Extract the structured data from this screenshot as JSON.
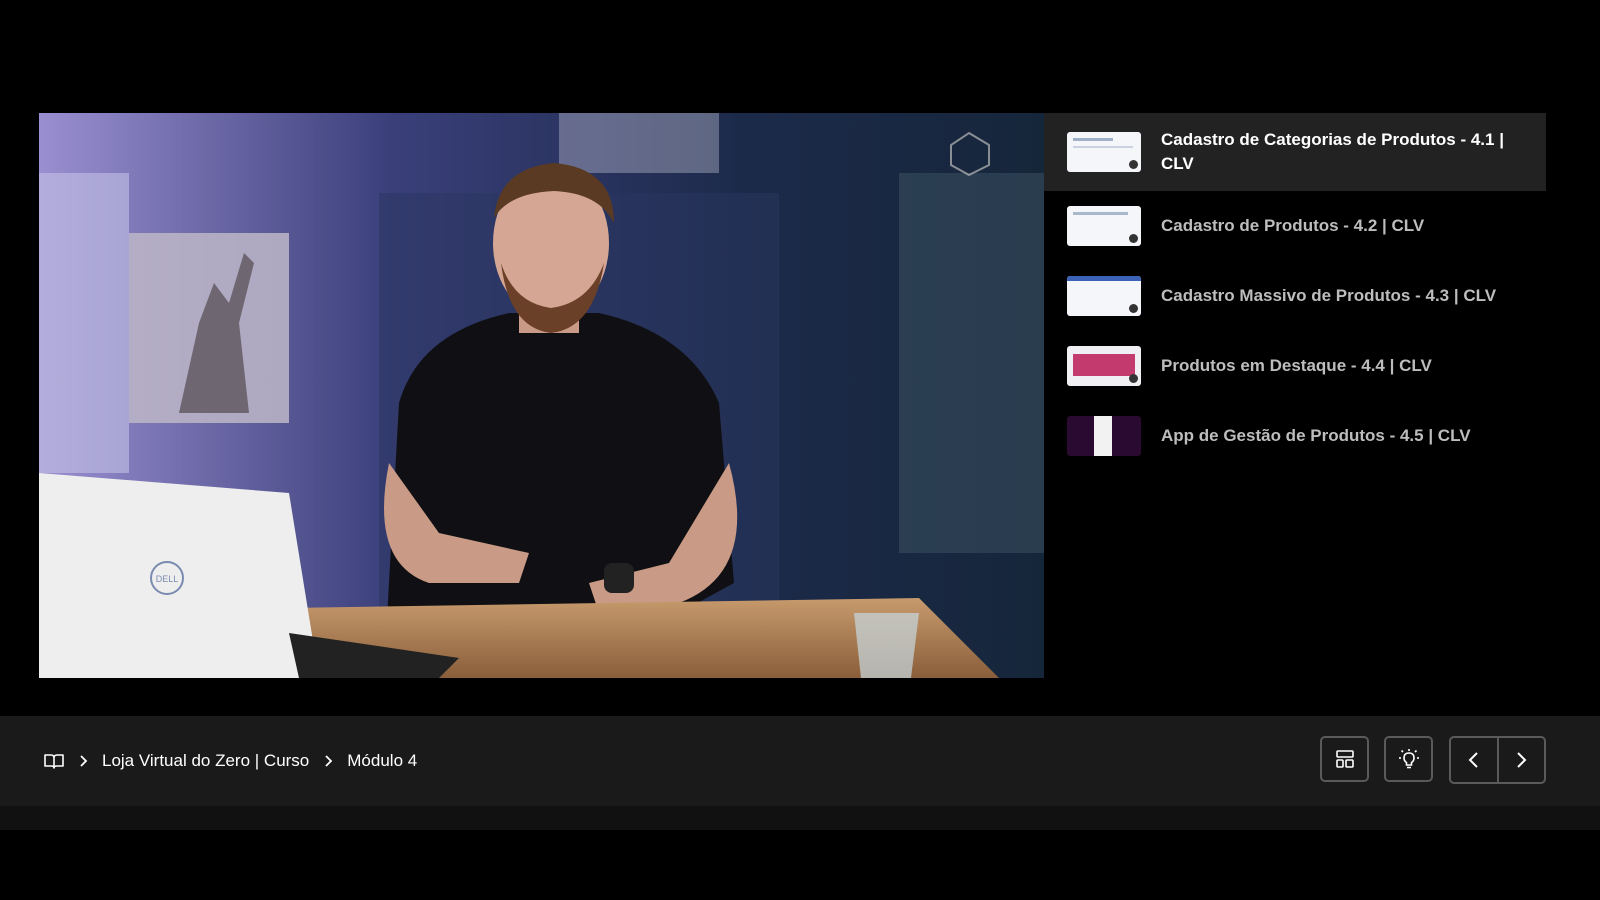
{
  "playlist": {
    "items": [
      {
        "title": "Cadastro de Categorias de Produtos - 4.1 | CLV",
        "active": true
      },
      {
        "title": "Cadastro de Produtos - 4.2 | CLV",
        "active": false
      },
      {
        "title": "Cadastro Massivo de Produtos - 4.3 | CLV",
        "active": false
      },
      {
        "title": "Produtos em Destaque - 4.4 | CLV",
        "active": false
      },
      {
        "title": "App de Gestão de Produtos - 4.5 | CLV",
        "active": false
      }
    ]
  },
  "breadcrumb": {
    "icon": "book-open-icon",
    "course": "Loja Virtual do Zero | Curso",
    "module": "Módulo 4"
  },
  "toolbar": {
    "layout_icon": "layout-icon",
    "theme_icon": "lightbulb-icon",
    "prev_icon": "chevron-left-icon",
    "next_icon": "chevron-right-icon"
  },
  "video": {
    "laptop_logo": "DELL"
  },
  "colors": {
    "background": "#000000",
    "bar": "#1a1a1a",
    "active_item": "#222222",
    "inactive_text": "#bdbdbd"
  }
}
